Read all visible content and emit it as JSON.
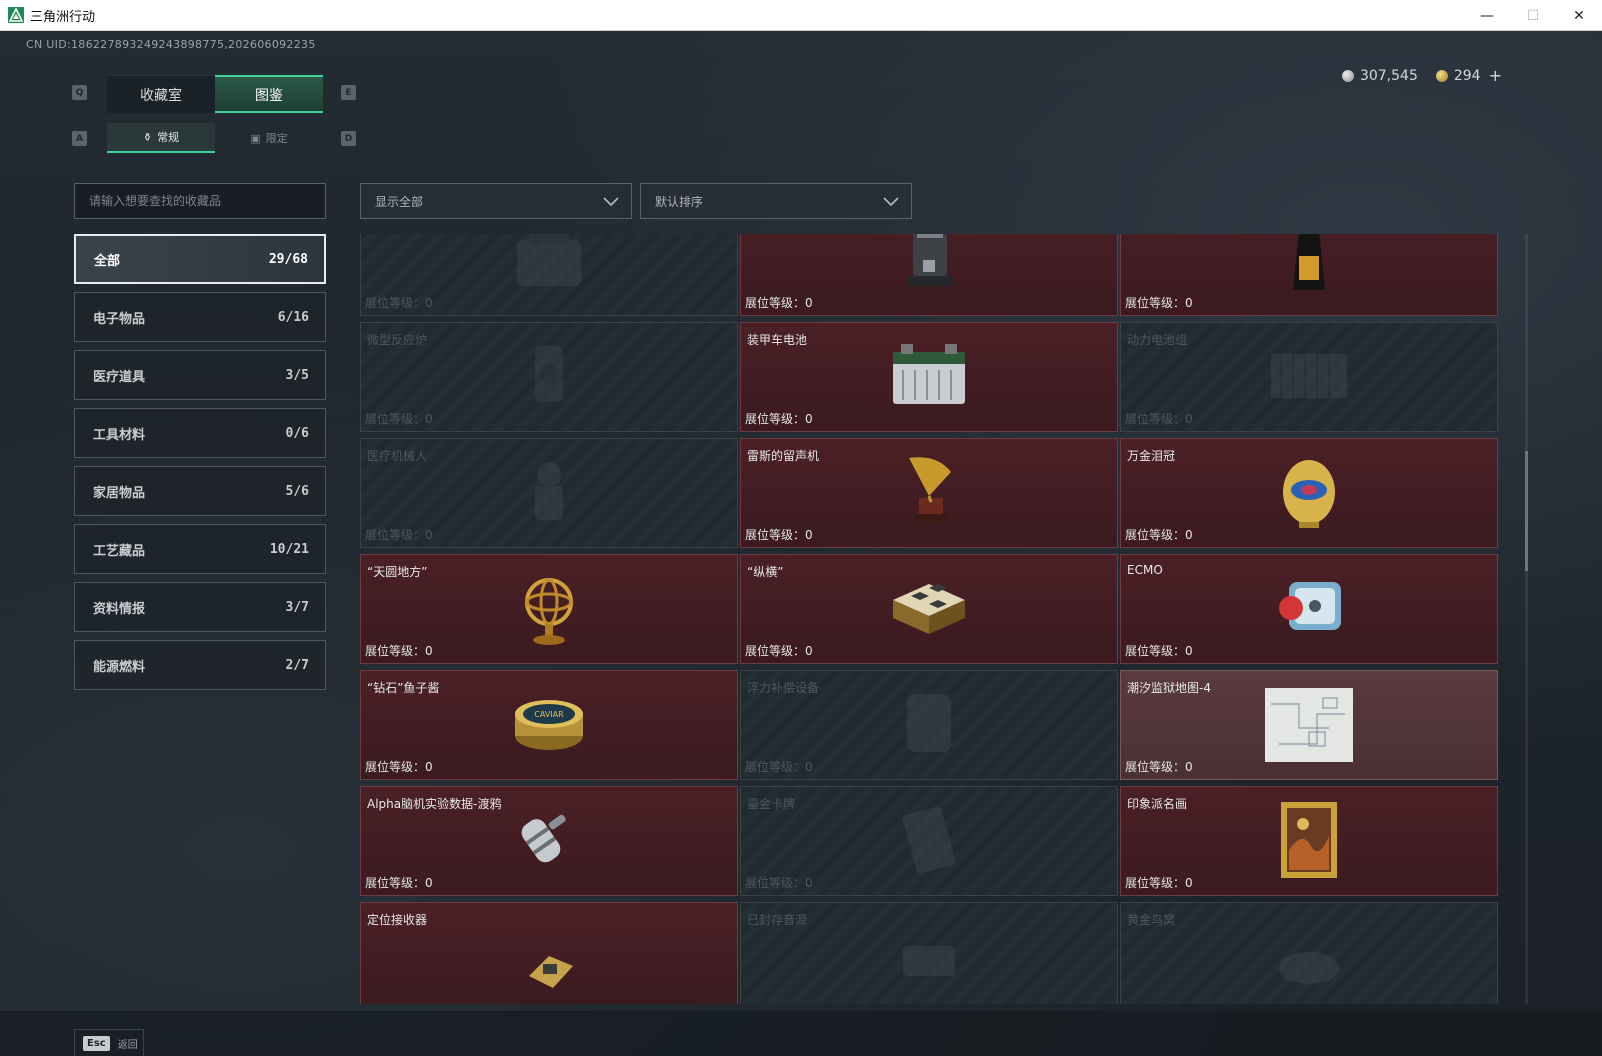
{
  "window": {
    "title": "三角洲行动",
    "minimize": "—",
    "maximize": "☐",
    "close": "✕"
  },
  "uid": "CN UID:1862278932492438987​75,202606092235",
  "currency": {
    "silver": "307,545",
    "gold": "294",
    "add": "+"
  },
  "keys": {
    "prev_tab": "Q",
    "next_tab": "E",
    "prev_sub": "A",
    "next_sub": "D"
  },
  "tabs": [
    {
      "label": "收藏室",
      "active": false
    },
    {
      "label": "图鉴",
      "active": true
    }
  ],
  "sub_tabs": [
    {
      "label": "常规",
      "icon": "bottle-icon",
      "active": true
    },
    {
      "label": "限定",
      "icon": "image-icon",
      "active": false
    }
  ],
  "search": {
    "placeholder": "请输入想要查找的收藏品",
    "value": ""
  },
  "filter": {
    "selected": "显示全部"
  },
  "sort": {
    "selected": "默认排序"
  },
  "categories": [
    {
      "label": "全部",
      "count": "29/68",
      "active": true
    },
    {
      "label": "电子物品",
      "count": "6/16"
    },
    {
      "label": "医疗道具",
      "count": "3/5"
    },
    {
      "label": "工具材料",
      "count": "0/6"
    },
    {
      "label": "家居物品",
      "count": "5/6"
    },
    {
      "label": "工艺藏品",
      "count": "10/21"
    },
    {
      "label": "资料情报",
      "count": "3/7"
    },
    {
      "label": "能源燃料",
      "count": "2/7"
    }
  ],
  "level_label": "展位等级：",
  "items": [
    {
      "name": "",
      "level": "0",
      "state": "locked",
      "icon": "bag-icon"
    },
    {
      "name": "",
      "level": "0",
      "state": "owned",
      "icon": "coffee-machine-icon"
    },
    {
      "name": "",
      "level": "0",
      "state": "owned",
      "icon": "coffee-bag-icon"
    },
    {
      "name": "微型反应炉",
      "level": "0",
      "state": "locked",
      "icon": "reactor-icon"
    },
    {
      "name": "装甲车电池",
      "level": "0",
      "state": "owned",
      "icon": "battery-icon"
    },
    {
      "name": "动力电池组",
      "level": "0",
      "state": "locked",
      "icon": "battery-pack-icon"
    },
    {
      "name": "医疗机械人",
      "level": "0",
      "state": "locked",
      "icon": "robot-icon"
    },
    {
      "name": "雷斯的留声机",
      "level": "0",
      "state": "owned",
      "icon": "gramophone-icon"
    },
    {
      "name": "万金泪冠",
      "level": "0",
      "state": "owned",
      "icon": "jeweled-egg-icon"
    },
    {
      "name": "“天圆地方”",
      "level": "0",
      "state": "owned",
      "icon": "armillary-sphere-icon"
    },
    {
      "name": "“纵横”",
      "level": "0",
      "state": "owned",
      "icon": "chess-box-icon"
    },
    {
      "name": "ECMO",
      "level": "0",
      "state": "owned",
      "icon": "ecmo-icon"
    },
    {
      "name": "“钻石”鱼子酱",
      "level": "0",
      "state": "owned",
      "icon": "caviar-tin-icon",
      "art_label": "CAVIAR"
    },
    {
      "name": "浮力补偿设备",
      "level": "0",
      "state": "locked",
      "icon": "buoyancy-device-icon"
    },
    {
      "name": "潮汐监狱地图-4",
      "level": "0",
      "state": "faded",
      "icon": "map-icon"
    },
    {
      "name": "Alpha脑机实验数据-渡鸦",
      "level": "0",
      "state": "owned",
      "icon": "data-drive-icon"
    },
    {
      "name": "鎏金卡牌",
      "level": "0",
      "state": "locked",
      "icon": "gold-card-icon"
    },
    {
      "name": "印象派名画",
      "level": "0",
      "state": "owned",
      "icon": "painting-icon"
    },
    {
      "name": "定位接收器",
      "level": "",
      "state": "owned",
      "icon": "receiver-icon"
    },
    {
      "name": "已封存音源",
      "level": "",
      "state": "locked",
      "icon": "sound-source-icon"
    },
    {
      "name": "黄金鸟窝",
      "level": "",
      "state": "locked",
      "icon": "gold-nest-icon"
    }
  ],
  "footer": {
    "esc_key": "Esc",
    "back_label": "返回"
  }
}
